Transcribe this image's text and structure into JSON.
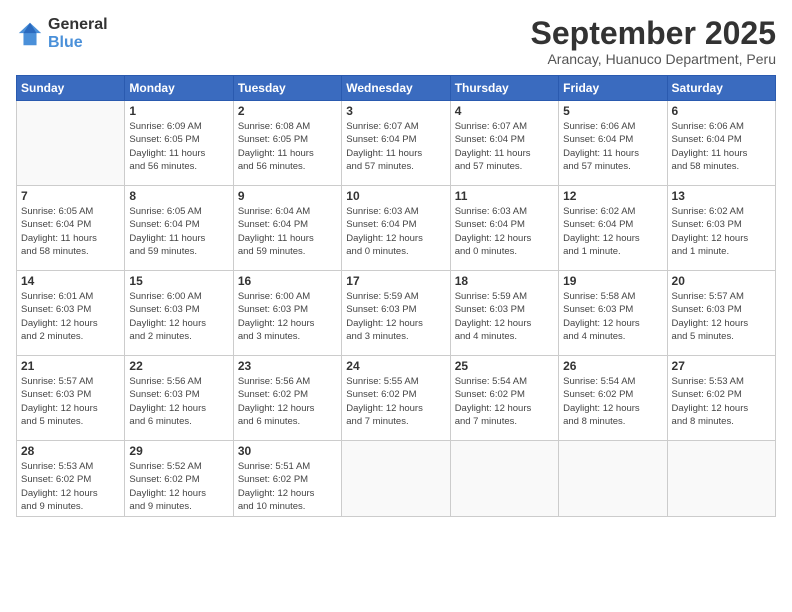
{
  "logo": {
    "line1": "General",
    "line2": "Blue"
  },
  "title": "September 2025",
  "subtitle": "Arancay, Huanuco Department, Peru",
  "days_header": [
    "Sunday",
    "Monday",
    "Tuesday",
    "Wednesday",
    "Thursday",
    "Friday",
    "Saturday"
  ],
  "weeks": [
    [
      {
        "day": "",
        "info": ""
      },
      {
        "day": "1",
        "info": "Sunrise: 6:09 AM\nSunset: 6:05 PM\nDaylight: 11 hours\nand 56 minutes."
      },
      {
        "day": "2",
        "info": "Sunrise: 6:08 AM\nSunset: 6:05 PM\nDaylight: 11 hours\nand 56 minutes."
      },
      {
        "day": "3",
        "info": "Sunrise: 6:07 AM\nSunset: 6:04 PM\nDaylight: 11 hours\nand 57 minutes."
      },
      {
        "day": "4",
        "info": "Sunrise: 6:07 AM\nSunset: 6:04 PM\nDaylight: 11 hours\nand 57 minutes."
      },
      {
        "day": "5",
        "info": "Sunrise: 6:06 AM\nSunset: 6:04 PM\nDaylight: 11 hours\nand 57 minutes."
      },
      {
        "day": "6",
        "info": "Sunrise: 6:06 AM\nSunset: 6:04 PM\nDaylight: 11 hours\nand 58 minutes."
      }
    ],
    [
      {
        "day": "7",
        "info": "Sunrise: 6:05 AM\nSunset: 6:04 PM\nDaylight: 11 hours\nand 58 minutes."
      },
      {
        "day": "8",
        "info": "Sunrise: 6:05 AM\nSunset: 6:04 PM\nDaylight: 11 hours\nand 59 minutes."
      },
      {
        "day": "9",
        "info": "Sunrise: 6:04 AM\nSunset: 6:04 PM\nDaylight: 11 hours\nand 59 minutes."
      },
      {
        "day": "10",
        "info": "Sunrise: 6:03 AM\nSunset: 6:04 PM\nDaylight: 12 hours\nand 0 minutes."
      },
      {
        "day": "11",
        "info": "Sunrise: 6:03 AM\nSunset: 6:04 PM\nDaylight: 12 hours\nand 0 minutes."
      },
      {
        "day": "12",
        "info": "Sunrise: 6:02 AM\nSunset: 6:04 PM\nDaylight: 12 hours\nand 1 minute."
      },
      {
        "day": "13",
        "info": "Sunrise: 6:02 AM\nSunset: 6:03 PM\nDaylight: 12 hours\nand 1 minute."
      }
    ],
    [
      {
        "day": "14",
        "info": "Sunrise: 6:01 AM\nSunset: 6:03 PM\nDaylight: 12 hours\nand 2 minutes."
      },
      {
        "day": "15",
        "info": "Sunrise: 6:00 AM\nSunset: 6:03 PM\nDaylight: 12 hours\nand 2 minutes."
      },
      {
        "day": "16",
        "info": "Sunrise: 6:00 AM\nSunset: 6:03 PM\nDaylight: 12 hours\nand 3 minutes."
      },
      {
        "day": "17",
        "info": "Sunrise: 5:59 AM\nSunset: 6:03 PM\nDaylight: 12 hours\nand 3 minutes."
      },
      {
        "day": "18",
        "info": "Sunrise: 5:59 AM\nSunset: 6:03 PM\nDaylight: 12 hours\nand 4 minutes."
      },
      {
        "day": "19",
        "info": "Sunrise: 5:58 AM\nSunset: 6:03 PM\nDaylight: 12 hours\nand 4 minutes."
      },
      {
        "day": "20",
        "info": "Sunrise: 5:57 AM\nSunset: 6:03 PM\nDaylight: 12 hours\nand 5 minutes."
      }
    ],
    [
      {
        "day": "21",
        "info": "Sunrise: 5:57 AM\nSunset: 6:03 PM\nDaylight: 12 hours\nand 5 minutes."
      },
      {
        "day": "22",
        "info": "Sunrise: 5:56 AM\nSunset: 6:03 PM\nDaylight: 12 hours\nand 6 minutes."
      },
      {
        "day": "23",
        "info": "Sunrise: 5:56 AM\nSunset: 6:02 PM\nDaylight: 12 hours\nand 6 minutes."
      },
      {
        "day": "24",
        "info": "Sunrise: 5:55 AM\nSunset: 6:02 PM\nDaylight: 12 hours\nand 7 minutes."
      },
      {
        "day": "25",
        "info": "Sunrise: 5:54 AM\nSunset: 6:02 PM\nDaylight: 12 hours\nand 7 minutes."
      },
      {
        "day": "26",
        "info": "Sunrise: 5:54 AM\nSunset: 6:02 PM\nDaylight: 12 hours\nand 8 minutes."
      },
      {
        "day": "27",
        "info": "Sunrise: 5:53 AM\nSunset: 6:02 PM\nDaylight: 12 hours\nand 8 minutes."
      }
    ],
    [
      {
        "day": "28",
        "info": "Sunrise: 5:53 AM\nSunset: 6:02 PM\nDaylight: 12 hours\nand 9 minutes."
      },
      {
        "day": "29",
        "info": "Sunrise: 5:52 AM\nSunset: 6:02 PM\nDaylight: 12 hours\nand 9 minutes."
      },
      {
        "day": "30",
        "info": "Sunrise: 5:51 AM\nSunset: 6:02 PM\nDaylight: 12 hours\nand 10 minutes."
      },
      {
        "day": "",
        "info": ""
      },
      {
        "day": "",
        "info": ""
      },
      {
        "day": "",
        "info": ""
      },
      {
        "day": "",
        "info": ""
      }
    ]
  ]
}
